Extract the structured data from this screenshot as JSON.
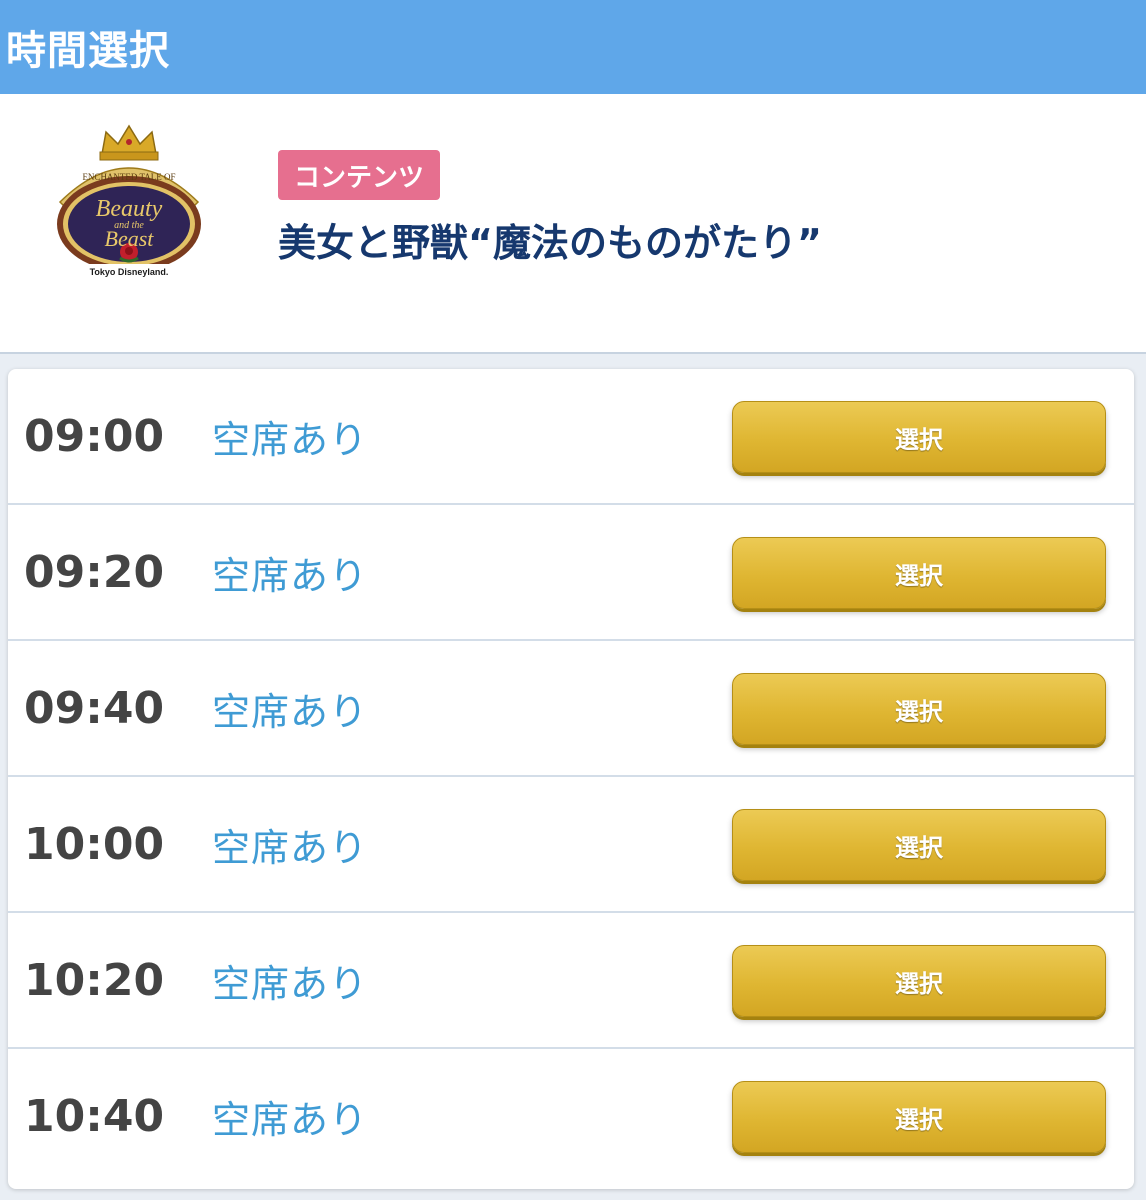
{
  "topbar": {
    "title": "時間選択"
  },
  "header": {
    "badge": "コンテンツ",
    "show_title": "美女と野獣“魔法のものがたり”",
    "logo": {
      "line1": "ENCHANTED TALE OF",
      "line2": "Beauty",
      "line3": "and the",
      "line4": "Beast",
      "line5": "Tokyo Disneyland."
    }
  },
  "colors": {
    "topbar": "#5fa7e9",
    "badge": "#e66f8f",
    "title": "#16386e",
    "status": "#3f9bd4",
    "button": "#dfb632"
  },
  "slots": [
    {
      "time": "09:00",
      "status": "空席あり",
      "button": "選択"
    },
    {
      "time": "09:20",
      "status": "空席あり",
      "button": "選択"
    },
    {
      "time": "09:40",
      "status": "空席あり",
      "button": "選択"
    },
    {
      "time": "10:00",
      "status": "空席あり",
      "button": "選択"
    },
    {
      "time": "10:20",
      "status": "空席あり",
      "button": "選択"
    },
    {
      "time": "10:40",
      "status": "空席あり",
      "button": "選択"
    }
  ]
}
